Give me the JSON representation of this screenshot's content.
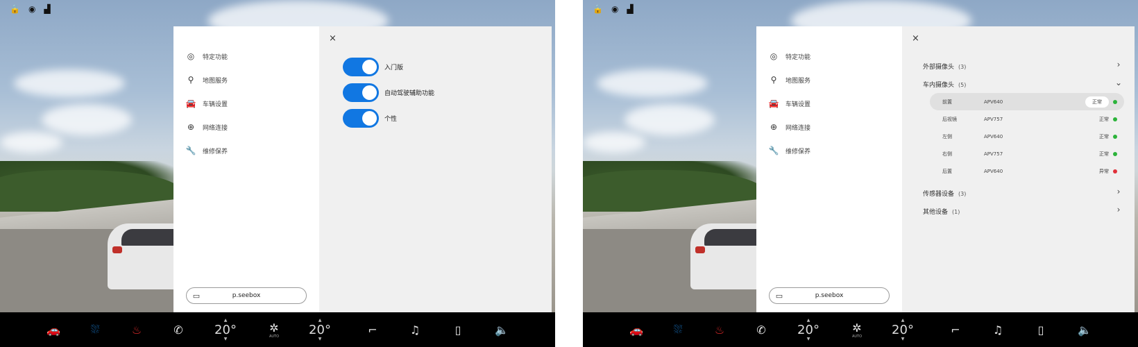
{
  "left": {
    "sidebar": {
      "items": [
        {
          "icon": "eye-icon",
          "label": "特定功能"
        },
        {
          "icon": "location-pin-icon",
          "label": "地图服务"
        },
        {
          "icon": "car-icon",
          "label": "车辆设置"
        },
        {
          "icon": "globe-icon",
          "label": "网络连接"
        },
        {
          "icon": "wrench-icon",
          "label": "维修保养"
        }
      ],
      "bottom_button": {
        "icon": "monitor-icon",
        "label": "p.seebox"
      }
    },
    "content": {
      "close_label": "×",
      "toggles": [
        {
          "label": "入门版",
          "state": "on"
        },
        {
          "label": "自动驾驶辅助功能",
          "state": "on"
        },
        {
          "label": "个性",
          "state": "on"
        }
      ]
    }
  },
  "right": {
    "sidebar": {
      "items": [
        {
          "icon": "eye-icon",
          "label": "特定功能"
        },
        {
          "icon": "location-pin-icon",
          "label": "地图服务"
        },
        {
          "icon": "car-icon",
          "label": "车辆设置"
        },
        {
          "icon": "globe-icon",
          "label": "网络连接"
        },
        {
          "icon": "wrench-icon",
          "label": "维修保养"
        }
      ],
      "bottom_button": {
        "icon": "monitor-icon",
        "label": "p.seebox"
      }
    },
    "content": {
      "close_label": "×",
      "sections_top": [
        {
          "title": "外部摄像头",
          "count": "(3)",
          "chevron": ">"
        },
        {
          "title": "车内摄像头",
          "count": "(5)",
          "chevron": "v"
        }
      ],
      "cameras": [
        {
          "name": "前置",
          "value": "APV640",
          "status": "正常",
          "color": "#2bb33a",
          "selected": true
        },
        {
          "name": "后视镜",
          "value": "APV757",
          "status": "正常",
          "color": "#2bb33a",
          "selected": false
        },
        {
          "name": "左侧",
          "value": "APV640",
          "status": "正常",
          "color": "#2bb33a",
          "selected": false
        },
        {
          "name": "右侧",
          "value": "APV757",
          "status": "正常",
          "color": "#2bb33a",
          "selected": false
        },
        {
          "name": "后置",
          "value": "APV640",
          "status": "异常",
          "color": "#e0303a",
          "selected": false
        }
      ],
      "sections_bottom": [
        {
          "title": "传感器设备",
          "count": "(3)",
          "chevron": ">"
        },
        {
          "title": "其他设备",
          "count": "(1)",
          "chevron": ">"
        }
      ]
    }
  },
  "taskbar": {
    "temp_left": "20°",
    "temp_right": "20°",
    "fan_label": "AUTO"
  },
  "colors": {
    "accent": "#1177e2",
    "ok": "#2bb33a",
    "error": "#e0303a",
    "seat_heat": "#d62828",
    "defrost": "#1a7fd6"
  }
}
